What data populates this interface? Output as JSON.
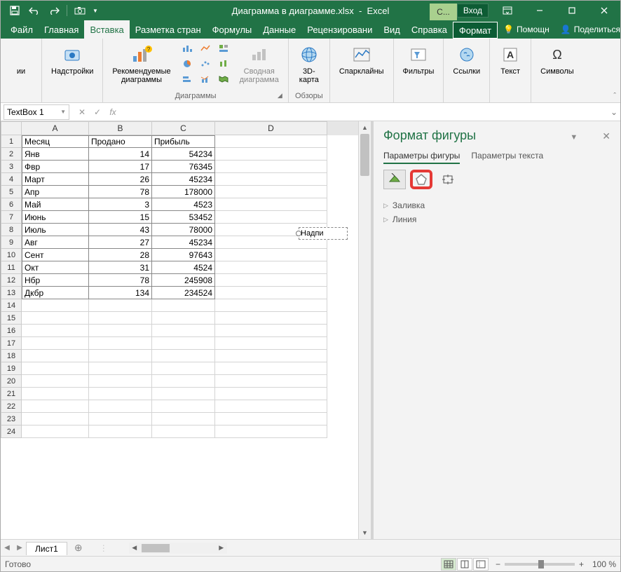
{
  "title": {
    "filename": "Диаграмма в диаграмме.xlsx",
    "app": "Excel",
    "signin": "Вход",
    "context": "С..."
  },
  "tabs": {
    "file": "Файл",
    "home": "Главная",
    "insert": "Вставка",
    "pageLayout": "Разметка стран",
    "formulas": "Формулы",
    "data": "Данные",
    "review": "Рецензировани",
    "view": "Вид",
    "help": "Справка",
    "format": "Формат",
    "tellme": "Помощн",
    "share": "Поделиться"
  },
  "ribbon": {
    "addins": "Надстройки",
    "addinsGroup": "ии",
    "recCharts": "Рекомендуемые\nдиаграммы",
    "chartsGroup": "Диаграммы",
    "pivotChart": "Сводная\nдиаграмма",
    "map3d": "3D-\nкарта",
    "toursGroup": "Обзоры",
    "sparklines": "Спарклайны",
    "filters": "Фильтры",
    "links": "Ссылки",
    "text": "Текст",
    "symbols": "Символы"
  },
  "namebox": "TextBox 1",
  "fx": "fx",
  "columns": [
    "A",
    "B",
    "C",
    "D"
  ],
  "headers": {
    "month": "Месяц",
    "sold": "Продано",
    "profit": "Прибыль"
  },
  "data_rows": [
    {
      "m": "Янв",
      "s": 14,
      "p": 54234
    },
    {
      "m": "Фвр",
      "s": 17,
      "p": 76345
    },
    {
      "m": "Март",
      "s": 26,
      "p": 45234
    },
    {
      "m": "Апр",
      "s": 78,
      "p": 178000
    },
    {
      "m": "Май",
      "s": 3,
      "p": 4523
    },
    {
      "m": "Июнь",
      "s": 15,
      "p": 53452
    },
    {
      "m": "Июль",
      "s": 43,
      "p": 78000
    },
    {
      "m": "Авг",
      "s": 27,
      "p": 45234
    },
    {
      "m": "Сент",
      "s": 28,
      "p": 97643
    },
    {
      "m": "Окт",
      "s": 31,
      "p": 4524
    },
    {
      "m": "Нбр",
      "s": 78,
      "p": 245908
    },
    {
      "m": "Дкбр",
      "s": 134,
      "p": 234524
    }
  ],
  "textbox": "Надпи",
  "pane": {
    "title": "Формат фигуры",
    "tab1": "Параметры фигуры",
    "tab2": "Параметры текста",
    "fill": "Заливка",
    "line": "Линия"
  },
  "sheet": "Лист1",
  "status": "Готово",
  "zoom": "100 %"
}
